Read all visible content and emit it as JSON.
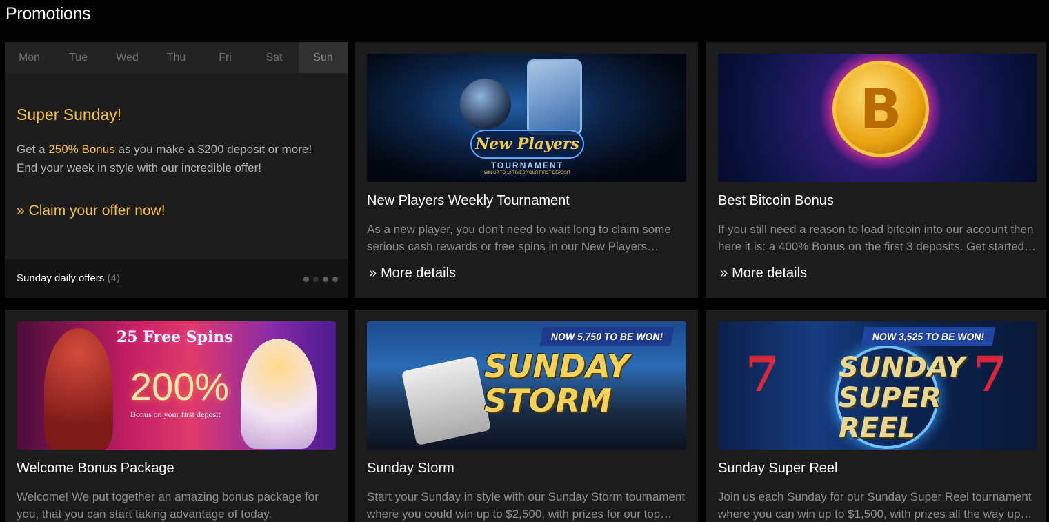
{
  "page": {
    "title": "Promotions"
  },
  "daily": {
    "days": [
      "Mon",
      "Tue",
      "Wed",
      "Thu",
      "Fri",
      "Sat",
      "Sun"
    ],
    "active_day": "Sun",
    "title": "Super Sunday!",
    "text_prefix": "Get a ",
    "text_highlight": "250% Bonus",
    "text_suffix": " as you make a $200 deposit or more! End your week in style with our incredible offer!",
    "claim_chevron": "»",
    "claim_label": "Claim your offer now!",
    "footer_label": "Sunday daily offers",
    "footer_count": "(4)",
    "dots": 4,
    "active_dot": 1
  },
  "promos": [
    {
      "title": "New Players Weekly Tournament",
      "description": "As a new player, you don't need to wait long to claim some serious cash rewards or free spins in our New Players Weekly Tournament",
      "more": "More details",
      "banner": {
        "title": "New Players",
        "subtitle": "TOURNAMENT",
        "tagline": "WIN UP TO 10 TIMES YOUR FIRST DEPOSIT"
      }
    },
    {
      "title": "Best Bitcoin Bonus",
      "description": "If you still need a reason to load bitcoin into our account then here it is: a 400% Bonus on the first 3 deposits. Get started today",
      "more": "More details",
      "banner": {
        "symbol": "B"
      }
    },
    {
      "title": "Welcome Bonus Package",
      "description": "Welcome! We put together an amazing bonus package for you, that you can start taking advantage of today.",
      "banner": {
        "spins": "25 Free Spins",
        "percent": "200%",
        "caption": "Bonus on your first deposit"
      }
    },
    {
      "title": "Sunday Storm",
      "description": "Start your Sunday in style with our Sunday Storm tournament where you could win up to $2,500, with prizes for our top players",
      "banner": {
        "badge": "NOW 5,750 TO BE WON!",
        "logo_line1": "SUNDAY",
        "logo_line2": "STORM"
      }
    },
    {
      "title": "Sunday Super Reel",
      "description": "Join us each Sunday for our Sunday Super Reel tournament where you can win up to $1,500, with prizes all the way up the leaderboard",
      "banner": {
        "badge": "NOW 3,525 TO BE WON!",
        "logo_line1": "SUNDAY",
        "logo_line2": "SUPER",
        "logo_line3": "REEL",
        "seven": "7"
      }
    }
  ],
  "colors": {
    "accent": "#f5c338",
    "card_bg": "#1c1c1c",
    "page_bg": "#000000"
  },
  "more_chevron": "»"
}
